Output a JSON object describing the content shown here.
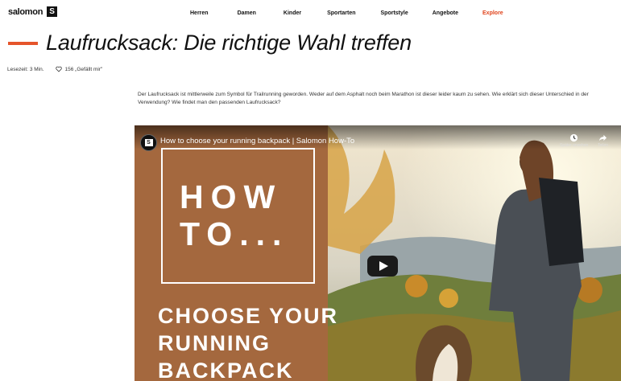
{
  "brand": {
    "wordmark": "salomon",
    "mark": "S"
  },
  "nav": [
    "Herren",
    "Damen",
    "Kinder",
    "Sportarten",
    "Sportstyle",
    "Angebote",
    "Explore"
  ],
  "colors": {
    "accent": "#e5542b",
    "explore": "#e0431b",
    "video_left": "#a4683e"
  },
  "article": {
    "title": "Laufrucksack: Die richtige Wahl treffen",
    "read_time": "Lesezeit: 3 Min.",
    "likes": "156 „Gefällt mir\"",
    "intro": "Der Laufrucksack ist mittlerweile zum Symbol für Trailrunning geworden. Weder auf dem Asphalt noch beim Marathon ist dieser leider kaum zu sehen. Wie erklärt sich dieser Unterschied in der Verwendung? Wie findet man den passenden Laufrucksack?"
  },
  "video": {
    "title": "How to choose your running backpack | Salomon How-To",
    "channel_mark": "S",
    "watch_later": "Später ansehen",
    "share": "Teilen",
    "overlay_howto": [
      "HOW",
      "TO..."
    ],
    "overlay_headline": [
      "CHOOSE YOUR",
      "RUNNING",
      "BACKPACK"
    ]
  }
}
